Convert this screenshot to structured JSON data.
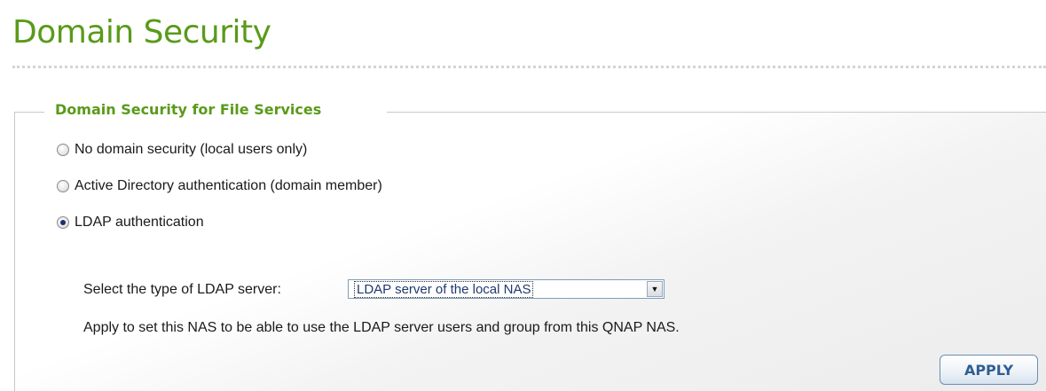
{
  "page": {
    "title": "Domain Security"
  },
  "section": {
    "legend": "Domain Security for File Services",
    "options": [
      {
        "label": "No domain security (local users only)",
        "checked": false
      },
      {
        "label": "Active Directory authentication (domain member)",
        "checked": false
      },
      {
        "label": "LDAP authentication",
        "checked": true
      }
    ],
    "ldap": {
      "select_label": "Select the type of LDAP server:",
      "selected_value": "LDAP server of the local NAS",
      "description": "Apply to set this NAS to be able to use the LDAP server users and group from this QNAP NAS."
    }
  },
  "actions": {
    "apply_label": "APPLY"
  },
  "colors": {
    "title_green": "#5a9a1a",
    "button_text": "#2e5f93"
  },
  "icons": {
    "dropdown": "chevron-down-icon",
    "radio": "radio-button-icon"
  }
}
